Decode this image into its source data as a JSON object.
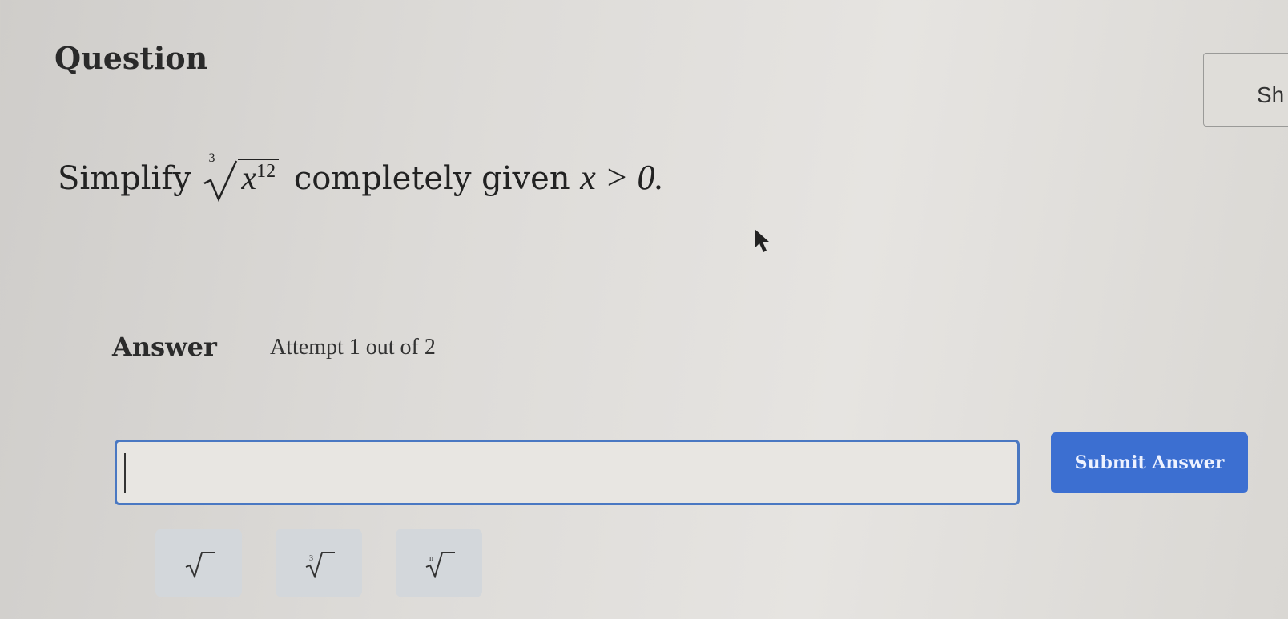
{
  "question": {
    "title": "Question",
    "show_button_label": "Sh",
    "prompt_prefix": "Simplify",
    "radical_index": "3",
    "radicand_base": "x",
    "radicand_exponent": "12",
    "prompt_middle": "completely given",
    "condition": "x > 0."
  },
  "answer": {
    "label": "Answer",
    "attempt_text": "Attempt 1 out of 2",
    "input_value": "",
    "submit_label": "Submit Answer"
  },
  "math_keys": [
    {
      "name": "square-root",
      "index": ""
    },
    {
      "name": "cube-root",
      "index": "3"
    },
    {
      "name": "nth-root",
      "index": "n"
    }
  ]
}
